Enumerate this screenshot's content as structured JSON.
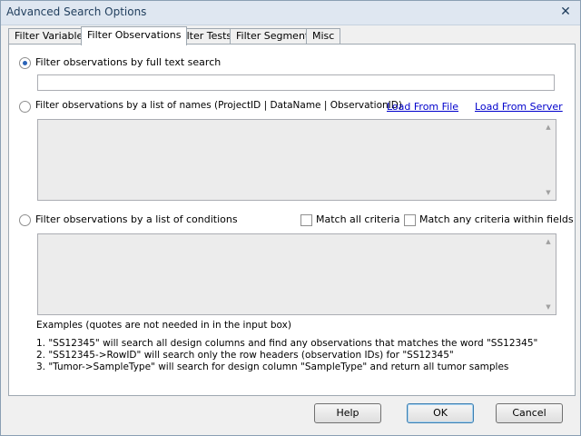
{
  "window": {
    "title": "Advanced Search Options",
    "close_glyph": "✕"
  },
  "tabs": [
    {
      "label": "Filter Variables"
    },
    {
      "label": "Filter Observations",
      "active": true
    },
    {
      "label": "Filter Tests"
    },
    {
      "label": "Filter Segments"
    },
    {
      "label": "Misc"
    }
  ],
  "fulltext": {
    "label": "Filter observations by full text search",
    "selected": true,
    "value": ""
  },
  "names": {
    "label": "Filter observations by  a  list of names (ProjectID  |  DataName  |  ObservationID)",
    "selected": false,
    "load_file": "Load From File",
    "load_server": "Load From Server"
  },
  "conditions": {
    "label": "Filter observations by a list of conditions",
    "selected": false,
    "match_all": "Match all criteria",
    "match_any": "Match any criteria within fields"
  },
  "examples": {
    "heading": "Examples (quotes are not needed in in the input box)",
    "lines": [
      "1.  \"SS12345\" will search all design columns and find any observations that matches the word \"SS12345\"",
      "2.  \"SS12345->RowID\" will search only the row headers (observation IDs) for \"SS12345\"",
      "3.  \"Tumor->SampleType\" will search for design column \"SampleType\" and return all tumor samples"
    ]
  },
  "buttons": {
    "help": "Help",
    "ok": "OK",
    "cancel": "Cancel"
  },
  "icons": {
    "scroll_up": "▲",
    "scroll_down": "▼"
  }
}
